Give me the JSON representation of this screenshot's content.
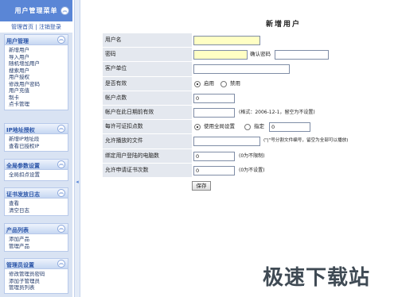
{
  "sidebar": {
    "title": "用户管理菜单",
    "top_links": {
      "home": "管理首页",
      "sep": " | ",
      "logout": "注销登录"
    },
    "groups": [
      {
        "title": "用户管理",
        "items": [
          "新增用户",
          "导入用户",
          "随机增加用户",
          "搜索用户",
          "用户授权",
          "修改用户密码",
          "用户充值",
          "制卡",
          "点卡管理"
        ]
      },
      {
        "title": "IP地址授权",
        "items": [
          "新增IP地址段",
          "查看已授权IP"
        ]
      },
      {
        "title": "全局参数设置",
        "items": [
          "全局扣点设置"
        ]
      },
      {
        "title": "证书发放日志",
        "items": [
          "查看",
          "清空日志"
        ]
      },
      {
        "title": "产品列表",
        "items": [
          "添加产品",
          "管理产品"
        ]
      },
      {
        "title": "管理员设置",
        "items": [
          "修改管理员密码",
          "添加子管理员",
          "管理员列表"
        ]
      }
    ]
  },
  "main": {
    "title": "新增用户",
    "fields": {
      "username": {
        "label": "用户名",
        "value": ""
      },
      "password": {
        "label": "密码",
        "value": "",
        "confirm_label": "确认密码",
        "confirm_value": ""
      },
      "company": {
        "label": "客户单位",
        "value": ""
      },
      "enabled": {
        "label": "是否有效",
        "opt_on": "启用",
        "opt_off": "禁用"
      },
      "points": {
        "label": "帐户点数",
        "value": "0"
      },
      "expiry": {
        "label": "帐户在此日期前有效",
        "value": "",
        "hint": "(格式：2006-12-1，留空为不设置)"
      },
      "deduct": {
        "label": "每许可证扣点数",
        "opt_global": "使用全局设置",
        "opt_custom": "指定",
        "value": "0"
      },
      "files": {
        "label": "允许播放的文件",
        "value": "",
        "hint": "(\"|\"号分割文件编号，留空为全部可以播放)"
      },
      "bind_pcs": {
        "label": "绑定用户登陆的电脑数",
        "value": "0",
        "hint": "(0为不限制)"
      },
      "cert_times": {
        "label": "允许申请证书次数",
        "value": "0",
        "hint": "(0为不设置)"
      }
    },
    "save_label": "保存"
  },
  "watermark": "极速下载站",
  "colors": {
    "sidebar_header": "#5a86d6",
    "sidebar_bg": "#d9e3f3",
    "label_bg": "#e4e8ef",
    "required_input": "#ffffc4"
  }
}
